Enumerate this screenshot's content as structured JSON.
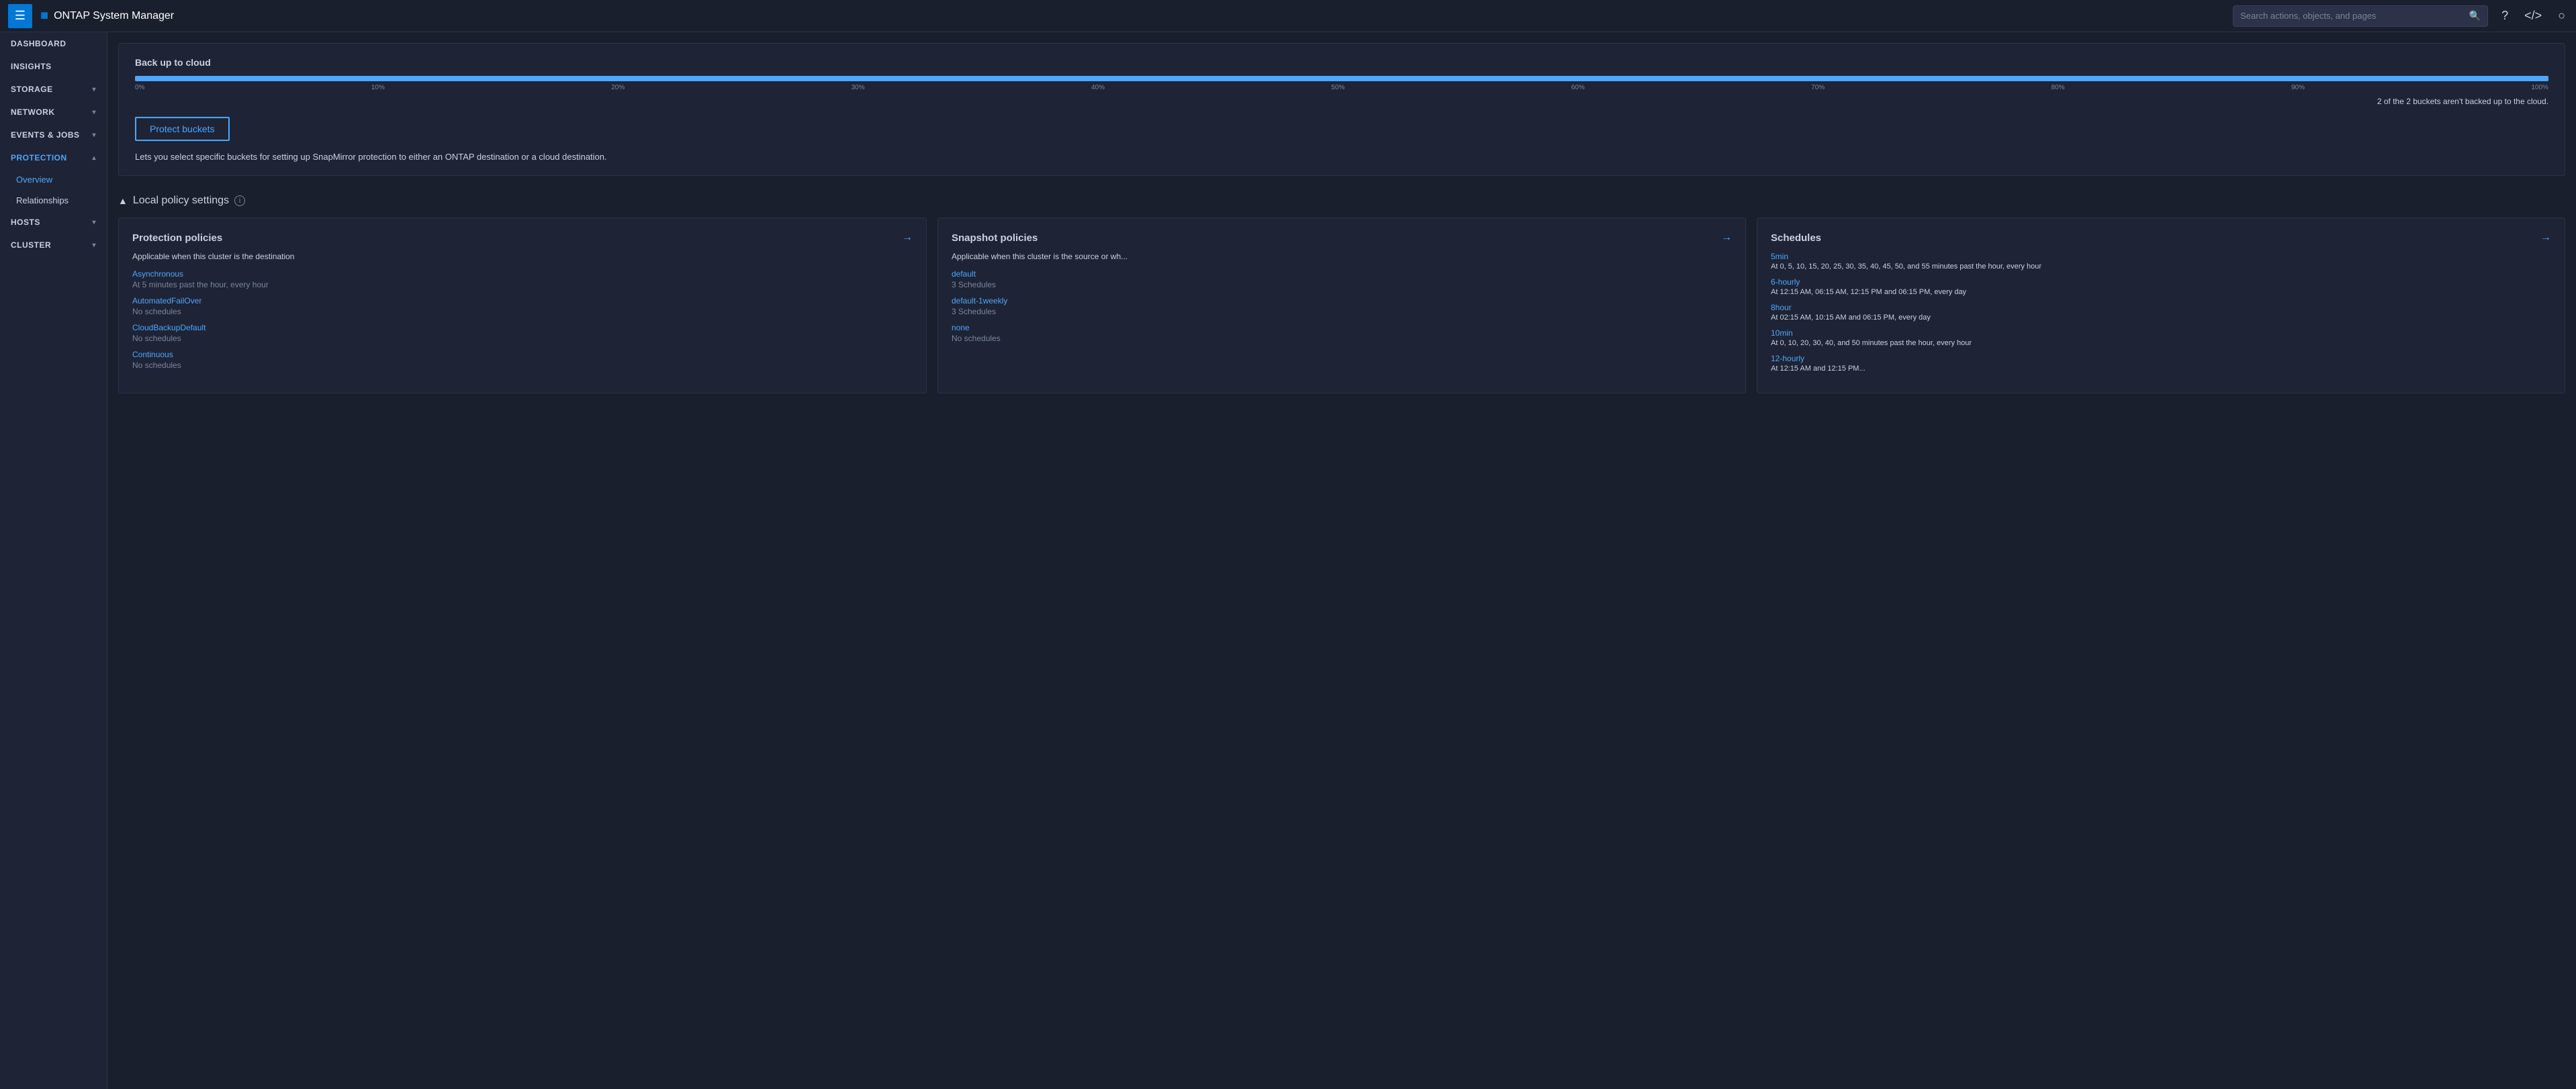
{
  "topnav": {
    "menu_label": "☰",
    "brand_icon": "■",
    "brand_title": "ONTAP System Manager",
    "search_placeholder": "Search actions, objects, and pages",
    "help_icon": "?",
    "code_icon": "</>",
    "user_icon": "○"
  },
  "sidebar": {
    "items": [
      {
        "id": "dashboard",
        "label": "DASHBOARD",
        "has_sub": false
      },
      {
        "id": "insights",
        "label": "INSIGHTS",
        "has_sub": false
      },
      {
        "id": "storage",
        "label": "STORAGE",
        "has_sub": true
      },
      {
        "id": "network",
        "label": "NETWORK",
        "has_sub": true
      },
      {
        "id": "events-jobs",
        "label": "EVENTS & JOBS",
        "has_sub": true
      },
      {
        "id": "protection",
        "label": "PROTECTION",
        "has_sub": true,
        "active": true
      }
    ],
    "protection_sub": [
      {
        "id": "overview",
        "label": "Overview",
        "active": true
      },
      {
        "id": "relationships",
        "label": "Relationships"
      }
    ],
    "bottom_items": [
      {
        "id": "hosts",
        "label": "HOSTS",
        "has_sub": true
      },
      {
        "id": "cluster",
        "label": "CLUSTER",
        "has_sub": true
      }
    ]
  },
  "backup_section": {
    "title": "Back up to cloud",
    "progress_percent": 100,
    "progress_labels": [
      "0%",
      "10%",
      "20%",
      "30%",
      "40%",
      "50%",
      "60%",
      "70%",
      "80%",
      "90%",
      "100%"
    ],
    "info_text": "2 of the  2 buckets aren't backed up to the cloud.",
    "protect_btn_label": "Protect buckets",
    "description": "Lets you select specific buckets for setting up SnapMirror protection to either an ONTAP destination or a cloud destination."
  },
  "local_policy": {
    "section_title": "Local policy settings",
    "info_icon": "i",
    "cards": {
      "protection_policies": {
        "title": "Protection policies",
        "arrow": "→",
        "subtitle": "Applicable when this cluster is the destination",
        "items": [
          {
            "name": "Asynchronous",
            "sub": "At 5 minutes past the hour, every hour"
          },
          {
            "name": "AutomatedFailOver",
            "sub": "No schedules"
          },
          {
            "name": "CloudBackupDefault",
            "sub": "No schedules"
          },
          {
            "name": "Continuous",
            "sub": "No schedules"
          }
        ]
      },
      "snapshot_policies": {
        "title": "Snapshot policies",
        "arrow": "→",
        "subtitle": "Applicable when this cluster is the source or wh...",
        "items": [
          {
            "name": "default",
            "sub": "3 Schedules"
          },
          {
            "name": "default-1weekly",
            "sub": "3 Schedules"
          },
          {
            "name": "none",
            "sub": "No schedules"
          }
        ]
      },
      "schedules": {
        "title": "Schedules",
        "arrow": "→",
        "items": [
          {
            "name": "5min",
            "desc": "At 0, 5, 10, 15, 20, 25, 30, 35, 40, 45, 50, and 55 minutes past the hour, every hour"
          },
          {
            "name": "6-hourly",
            "desc": "At 12:15 AM, 06:15 AM, 12:15 PM and 06:15 PM, every day"
          },
          {
            "name": "8hour",
            "desc": "At 02:15 AM, 10:15 AM and 06:15 PM, every day"
          },
          {
            "name": "10min",
            "desc": "At 0, 10, 20, 30, 40, and 50 minutes past the hour, every hour"
          },
          {
            "name": "12-hourly",
            "desc": "At 12:15 AM and 12:15 PM..."
          }
        ]
      }
    }
  }
}
